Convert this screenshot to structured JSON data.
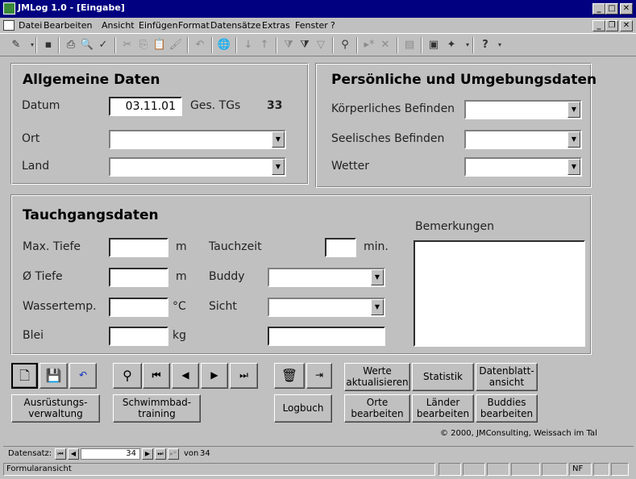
{
  "window": {
    "title": "JMLog 1.0 - [Eingabe]"
  },
  "menu": [
    "Datei",
    "Bearbeiten",
    "Ansicht",
    "Einfügen",
    "Format",
    "Datensätze",
    "Extras",
    "Fenster",
    "?"
  ],
  "general": {
    "heading": "Allgemeine Daten",
    "date_label": "Datum",
    "date_value": "03.11.01",
    "tgs_label": "Ges. TGs",
    "tgs_value": "33",
    "ort_label": "Ort",
    "land_label": "Land"
  },
  "personal": {
    "heading": "Persönliche und Umgebungsdaten",
    "body_label": "Körperliches Befinden",
    "mind_label": "Seelisches Befinden",
    "weather_label": "Wetter"
  },
  "dive": {
    "heading": "Tauchgangsdaten",
    "maxdepth_label": "Max. Tiefe",
    "maxdepth_unit": "m",
    "avgdepth_label": "Ø Tiefe",
    "avgdepth_unit": "m",
    "temp_label": "Wassertemp.",
    "temp_unit": "°C",
    "lead_label": "Blei",
    "lead_unit": "kg",
    "time_label": "Tauchzeit",
    "time_unit": "min.",
    "buddy_label": "Buddy",
    "sight_label": "Sicht",
    "remarks_label": "Bemerkungen"
  },
  "buttons": {
    "equipment": "Ausrüstungs-\nverwaltung",
    "pool": "Schwimmbad-\ntraining",
    "logbook": "Logbuch",
    "refresh": "Werte\naktualisieren",
    "stats": "Statistik",
    "sheet": "Datenblatt-\nansicht",
    "places": "Orte\nbearbeiten",
    "countries": "Länder\nbearbeiten",
    "buddies": "Buddies\nbearbeiten"
  },
  "copyright": "© 2000, JMConsulting, Weissach im Tal",
  "recordnav": {
    "label": "Datensatz:",
    "current": "34",
    "of_label": "von",
    "total": "34"
  },
  "status": {
    "text": "Formularansicht",
    "nf": "NF"
  }
}
